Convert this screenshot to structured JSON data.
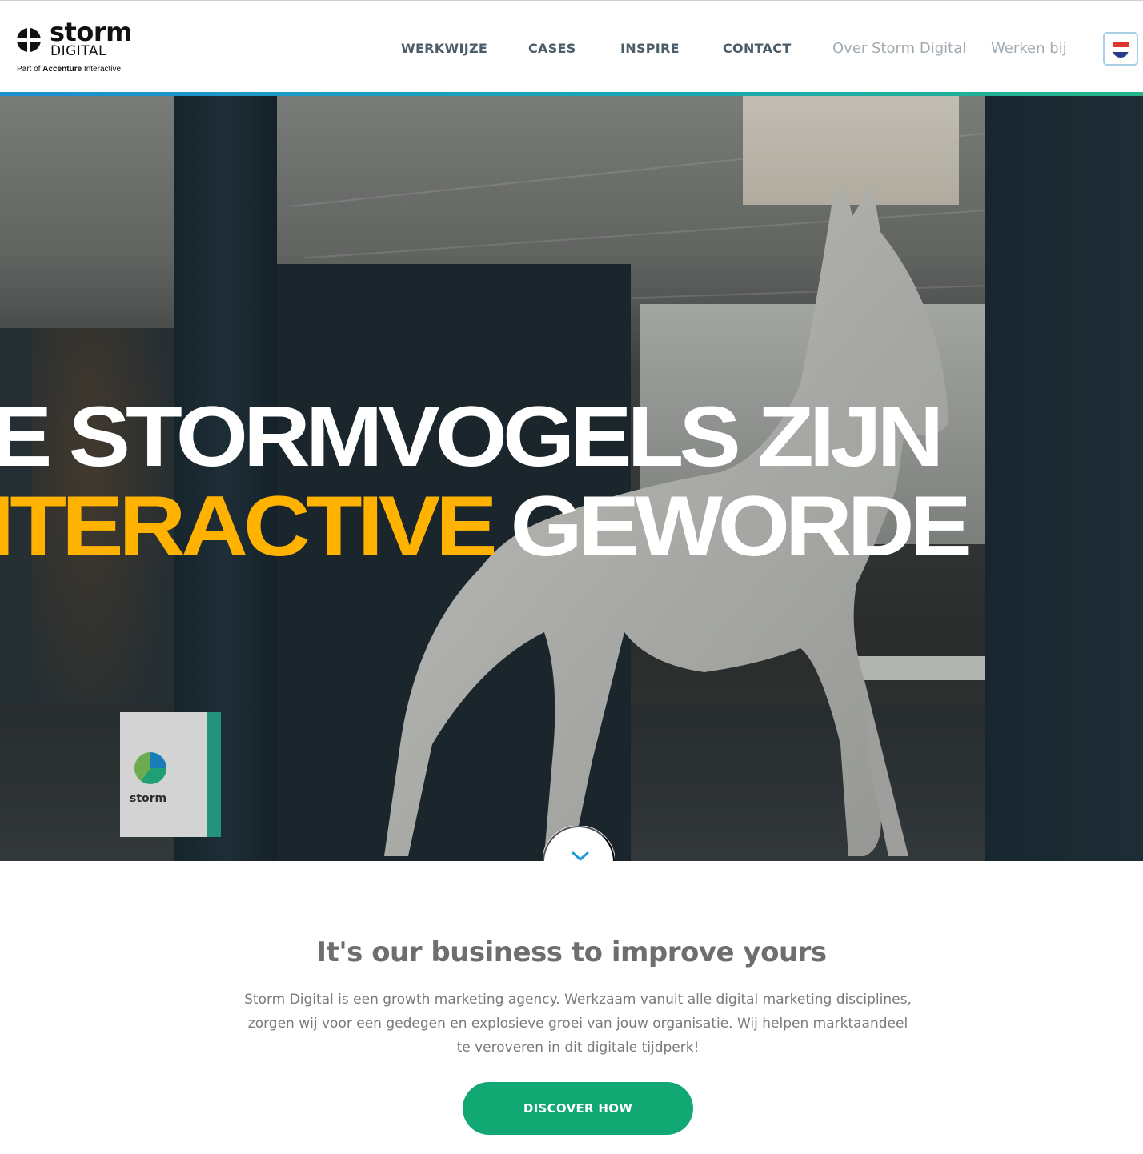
{
  "brand": {
    "word": "storm",
    "sub": "DIGITAL",
    "part_of_prefix": "Part of ",
    "part_of_name": "Accenture",
    "part_of_suffix": " Interactive"
  },
  "nav": {
    "items": [
      {
        "label": "WERKWIJZE"
      },
      {
        "label": "CASES"
      },
      {
        "label": "INSPIRE"
      },
      {
        "label": "CONTACT"
      },
      {
        "label": "Over Storm Digital"
      },
      {
        "label": "Werken bij"
      }
    ],
    "language_icon": "netherlands-flag-icon"
  },
  "hero": {
    "line1": "E STORMVOGELS ZIJN",
    "line2_highlight": "ITERACTIVE",
    "line2_rest": "GEWORDE",
    "box_logo_word": "storm",
    "highlight_color": "#ffb300",
    "scroll_icon": "chevron-down-icon"
  },
  "main": {
    "title": "It's our business to improve yours",
    "text": "Storm Digital is een growth marketing agency. Werkzaam vanuit alle digital marketing disciplines, zorgen wij voor een gedegen en explosieve groei van jouw organisatie. Wij helpen marktaandeel te veroveren in dit digitale tijdperk!",
    "cta_label": "DISCOVER HOW",
    "cta_color": "#11a873"
  }
}
